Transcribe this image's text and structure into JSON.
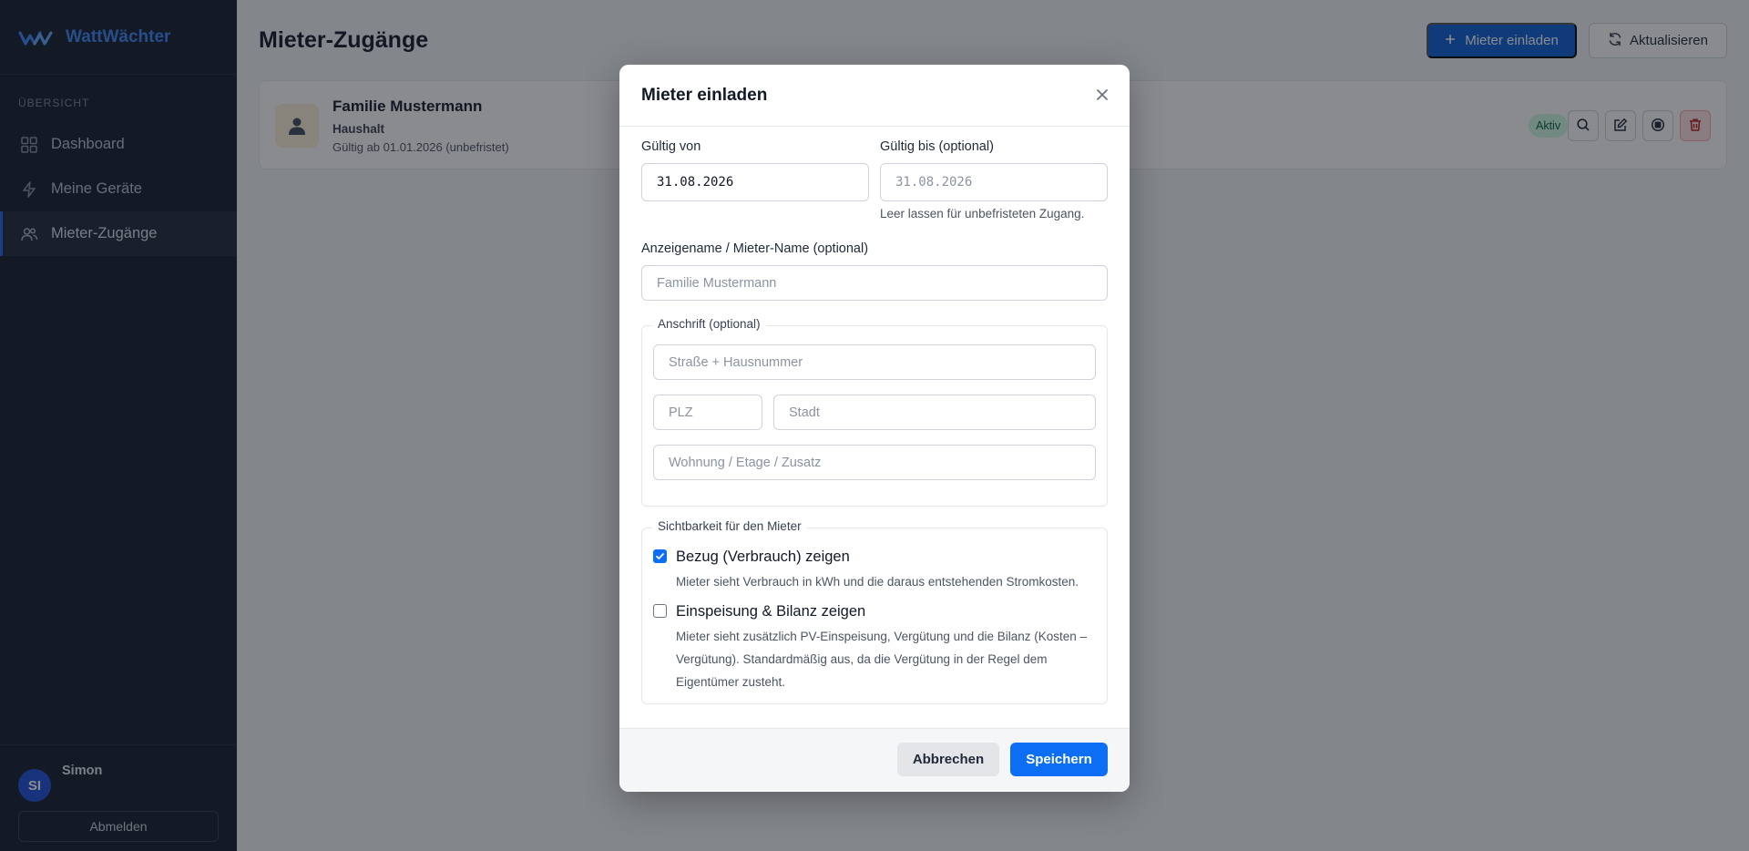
{
  "app": {
    "name": "WattWächter"
  },
  "sidebar": {
    "section_heading": "ÜBERSICHT",
    "items": [
      {
        "label": "Dashboard",
        "icon": "grid-icon"
      },
      {
        "label": "Meine Geräte",
        "icon": "bolt-icon"
      },
      {
        "label": "Mieter-Zugänge",
        "icon": "users-icon",
        "active": true
      }
    ],
    "user": {
      "initials": "SI",
      "name": "Simon"
    },
    "logout_label": "Abmelden"
  },
  "header": {
    "title": "Mieter-Zugänge",
    "invite_label": "Mieter einladen",
    "refresh_label": "Aktualisieren"
  },
  "tenants": [
    {
      "name": "Familie Mustermann",
      "type": "Haushalt",
      "validity": "Gültig ab 01.01.2026 (unbefristet)",
      "status": "Aktiv"
    }
  ],
  "modal": {
    "title": "Mieter einladen",
    "valid_from_label": "Gültig von",
    "valid_from_value": "31.08.2026",
    "valid_to_label": "Gültig bis (optional)",
    "valid_to_placeholder": "31.08.2026",
    "valid_to_hint": "Leer lassen für unbefristeten Zugang.",
    "display_name_label": "Anzeigename / Mieter-Name (optional)",
    "display_name_placeholder": "Familie Mustermann",
    "address_legend": "Anschrift (optional)",
    "street_placeholder": "Straße + Hausnummer",
    "zip_placeholder": "PLZ",
    "city_placeholder": "Stadt",
    "apartment_placeholder": "Wohnung / Etage / Zusatz",
    "visibility_legend": "Sichtbarkeit für den Mieter",
    "consumption": {
      "label": "Bezug (Verbrauch) zeigen",
      "checked": true,
      "description": "Mieter sieht Verbrauch in kWh und die daraus entstehenden Stromkosten."
    },
    "feedin": {
      "label": "Einspeisung & Bilanz zeigen",
      "checked": false,
      "description": "Mieter sieht zusätzlich PV-Einspeisung, Vergütung und die Bilanz (Kosten – Vergütung). Standardmäßig aus, da die Vergütung in der Regel dem Eigentümer zusteht."
    },
    "cancel_label": "Abbrechen",
    "save_label": "Speichern"
  },
  "colors": {
    "primary": "#0b6ef4",
    "sidebar_bg": "#131c2b",
    "brand": "#3b82f6",
    "badge_bg": "#d1fae5"
  }
}
